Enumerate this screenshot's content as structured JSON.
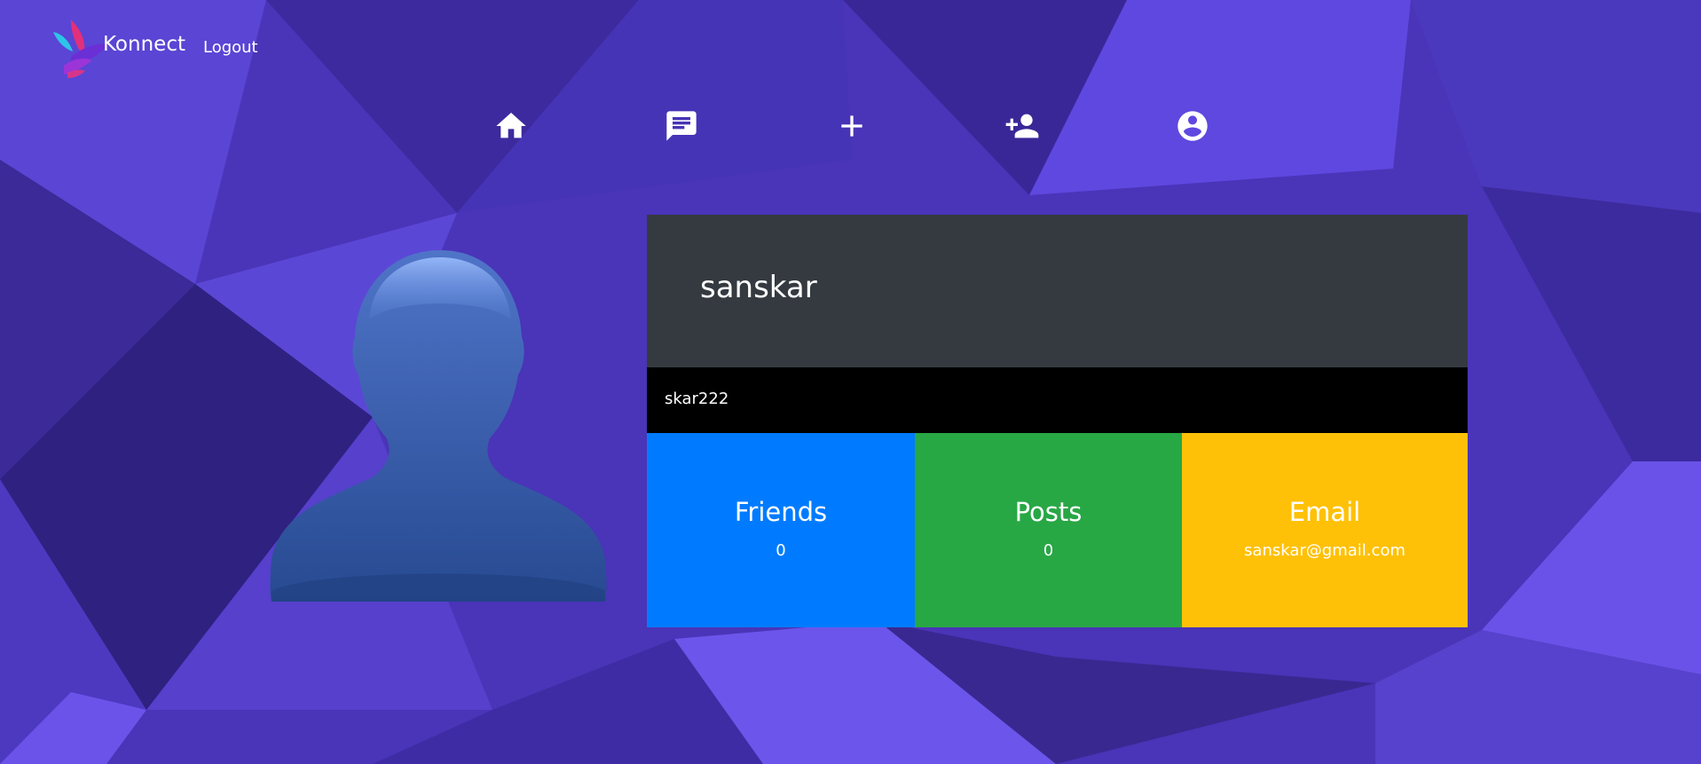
{
  "brand": {
    "name": "Konnect",
    "logout_label": "Logout"
  },
  "nav": {
    "icons": [
      "home-icon",
      "chat-icon",
      "plus-icon",
      "add-friend-icon",
      "account-circle-icon"
    ]
  },
  "profile": {
    "name": "sanskar",
    "username": "skar222",
    "stats": {
      "friends_label": "Friends",
      "friends_value": "0",
      "posts_label": "Posts",
      "posts_value": "0",
      "email_label": "Email",
      "email_value": "sanskar@gmail.com"
    }
  },
  "colors": {
    "background": "#4a34b8",
    "header": "#343a40",
    "handle_bar": "#000000",
    "friends": "#007bff",
    "posts": "#28a745",
    "email": "#ffc107"
  }
}
